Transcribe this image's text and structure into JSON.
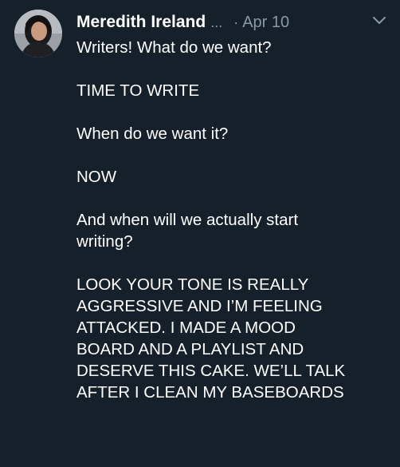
{
  "tweet": {
    "author_name": "Meredith Ireland",
    "name_overflow": "...",
    "separator": "·",
    "date": "Apr 10",
    "menu_icon": "chevron-down-icon",
    "avatar_icon": "profile-photo",
    "lines": [
      "Writers! What do we want?",
      "TIME TO WRITE",
      "When do we want it?",
      "NOW",
      "And when will we actually start",
      "writing?",
      "LOOK YOUR TONE IS REALLY",
      "AGGRESSIVE AND I’M FEELING",
      "ATTACKED. I MADE A MOOD",
      "BOARD AND A PLAYLIST AND",
      "DESERVE THIS CAKE. WE’LL TALK",
      "AFTER I CLEAN MY BASEBOARDS"
    ]
  },
  "colors": {
    "background": "#15202b",
    "text": "#ffffff",
    "secondary": "#8899a6"
  }
}
